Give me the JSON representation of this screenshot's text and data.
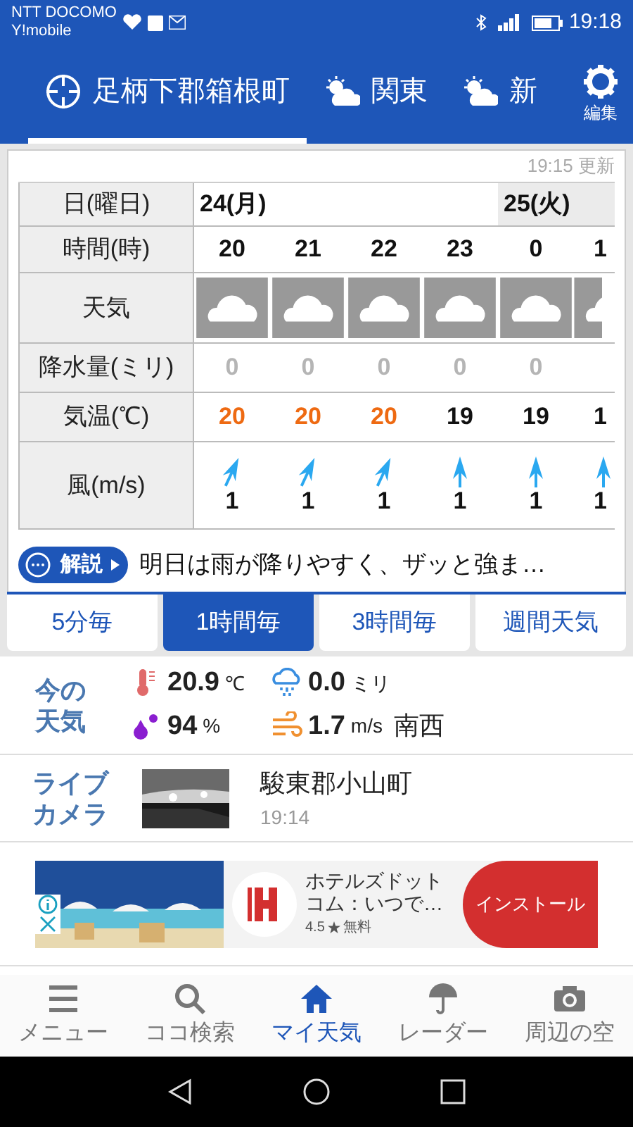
{
  "status_bar": {
    "carriers": [
      "NTT DOCOMO",
      "Y!mobile"
    ],
    "time": "19:18"
  },
  "location_tabs": [
    {
      "label": "足柄下郡箱根町",
      "kind": "current",
      "selected": true
    },
    {
      "label": "関東",
      "kind": "weather",
      "selected": false
    },
    {
      "label": "新",
      "kind": "weather",
      "selected": false
    }
  ],
  "settings": {
    "label": "編集"
  },
  "forecast": {
    "updated": "19:15 更新",
    "row_labels": [
      "日(曜日)",
      "時間(時)",
      "天気",
      "降水量(ミリ)",
      "気温(℃)",
      "風(m/s)"
    ],
    "days": [
      {
        "label": "24(月)",
        "shaded": false,
        "columns": [
          {
            "hour": "20",
            "precip": "0",
            "temp": "20",
            "warm": true,
            "kind": "tilted",
            "wind": "1"
          },
          {
            "hour": "21",
            "precip": "0",
            "temp": "20",
            "warm": true,
            "kind": "tilted",
            "wind": "1"
          },
          {
            "hour": "22",
            "precip": "0",
            "temp": "20",
            "warm": true,
            "kind": "tilted",
            "wind": "1"
          },
          {
            "hour": "23",
            "precip": "0",
            "temp": "19",
            "warm": false,
            "kind": "up",
            "wind": "1"
          }
        ]
      },
      {
        "label": "25(火)",
        "shaded": true,
        "columns": [
          {
            "hour": "0",
            "precip": "0",
            "temp": "19",
            "warm": false,
            "kind": "up",
            "wind": "1"
          },
          {
            "hour": "1",
            "temp": "1",
            "warm": false,
            "kind": "up",
            "wind": "1"
          }
        ]
      }
    ],
    "comment_button": "解説",
    "comment": "明日は雨が降りやすく、ザッと強ま…"
  },
  "interval_tabs": [
    {
      "label": "5分毎",
      "selected": false
    },
    {
      "label": "1時間毎",
      "selected": true
    },
    {
      "label": "3時間毎",
      "selected": false
    },
    {
      "label": "週間天気",
      "selected": false
    }
  ],
  "current": {
    "title": "今の天気",
    "items": [
      {
        "kind": "temp",
        "value": "20.9",
        "unit": "℃"
      },
      {
        "kind": "rain",
        "value": "0.0",
        "unit": "ミリ"
      },
      {
        "kind": "humidity",
        "value": "94",
        "unit": "%"
      },
      {
        "kind": "wind",
        "value": "1.7",
        "unit": "m/s",
        "extra": "南西"
      }
    ]
  },
  "live_camera": {
    "title": "ライブカメラ",
    "place": "駿東郡小山町",
    "time": "19:14"
  },
  "ad": {
    "app_name": "ホテルズドットコム：いつで…",
    "rating": "4.5",
    "price": "無料",
    "button": "インストール"
  },
  "bottom_nav": [
    {
      "label": "メニュー",
      "kind": "menu",
      "selected": false
    },
    {
      "label": "ココ検索",
      "kind": "search",
      "selected": false
    },
    {
      "label": "マイ天気",
      "kind": "home",
      "selected": true
    },
    {
      "label": "レーダー",
      "kind": "radar",
      "selected": false
    },
    {
      "label": "周辺の空",
      "kind": "camera",
      "selected": false
    }
  ]
}
